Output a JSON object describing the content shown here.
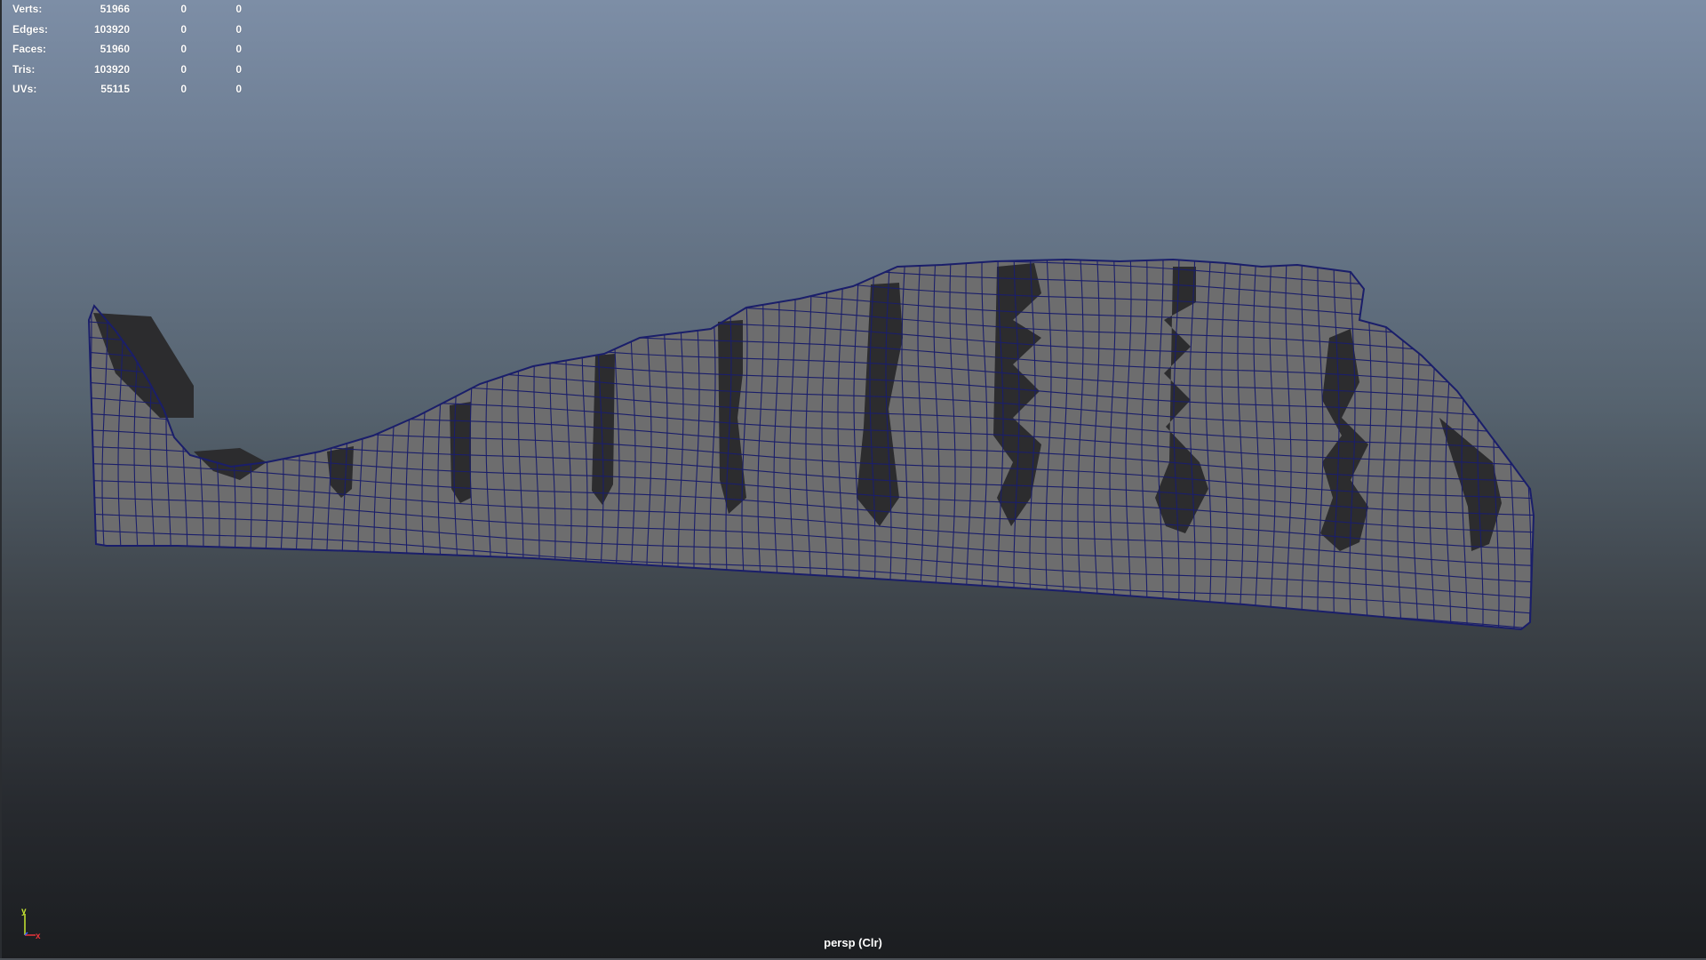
{
  "viewport": {
    "camera": "persp (Clr)",
    "colors": {
      "mesh_fill": "#6d6d6e",
      "mesh_wire": "#1a1e6a",
      "cavity": "#2c2c2e",
      "background_top": "#7d8ea6",
      "background_bottom": "#1b1d20"
    }
  },
  "hud": {
    "rows": [
      {
        "label": "Verts:",
        "v1": "51966",
        "v2": "0",
        "v3": "0"
      },
      {
        "label": "Edges:",
        "v1": "103920",
        "v2": "0",
        "v3": "0"
      },
      {
        "label": "Faces:",
        "v1": "51960",
        "v2": "0",
        "v3": "0"
      },
      {
        "label": "Tris:",
        "v1": "103920",
        "v2": "0",
        "v3": "0"
      },
      {
        "label": "UVs:",
        "v1": "55115",
        "v2": "0",
        "v3": "0"
      }
    ]
  },
  "axis": {
    "y_label": "y",
    "x_label": "x",
    "y_color": "#c8e832",
    "x_color": "#e8343a",
    "z_color": "#3a5cff"
  }
}
